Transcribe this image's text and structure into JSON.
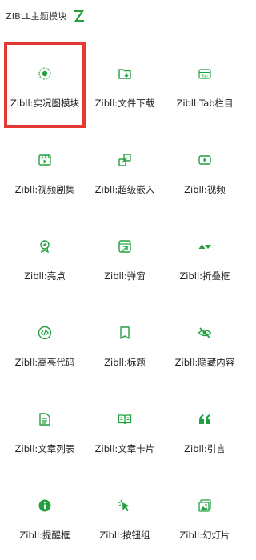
{
  "header": {
    "title": "ZIBLL主题模块",
    "logo_icon": "zibll-logo-icon"
  },
  "accent_color": "#22a03f",
  "selection_color": "#e53935",
  "blocks": [
    {
      "label": "Zibll:实况图模块",
      "icon": "live-photo-icon",
      "selected": true
    },
    {
      "label": "Zibll:文件下载",
      "icon": "folder-download-icon",
      "selected": false
    },
    {
      "label": "Zibll:Tab栏目",
      "icon": "tab-icon",
      "selected": false
    },
    {
      "label": "Zibll:视频剧集",
      "icon": "video-episodes-icon",
      "selected": false
    },
    {
      "label": "Zibll:超级嵌入",
      "icon": "embed-icon",
      "selected": false
    },
    {
      "label": "Zibll:视频",
      "icon": "video-icon",
      "selected": false
    },
    {
      "label": "Zibll:亮点",
      "icon": "award-icon",
      "selected": false
    },
    {
      "label": "Zibll:弹窗",
      "icon": "popup-icon",
      "selected": false
    },
    {
      "label": "Zibll:折叠框",
      "icon": "collapse-icon",
      "selected": false
    },
    {
      "label": "Zibll:高亮代码",
      "icon": "code-icon",
      "selected": false
    },
    {
      "label": "Zibll:标题",
      "icon": "bookmark-icon",
      "selected": false
    },
    {
      "label": "Zibll:隐藏内容",
      "icon": "eye-hidden-icon",
      "selected": false
    },
    {
      "label": "Zibll:文章列表",
      "icon": "article-list-icon",
      "selected": false
    },
    {
      "label": "Zibll:文章卡片",
      "icon": "book-card-icon",
      "selected": false
    },
    {
      "label": "Zibll:引言",
      "icon": "quote-icon",
      "selected": false
    },
    {
      "label": "Zibll:提醒框",
      "icon": "info-icon",
      "selected": false
    },
    {
      "label": "Zibll:按钮组",
      "icon": "pointer-click-icon",
      "selected": false
    },
    {
      "label": "Zibll:幻灯片",
      "icon": "slides-icon",
      "selected": false
    }
  ]
}
